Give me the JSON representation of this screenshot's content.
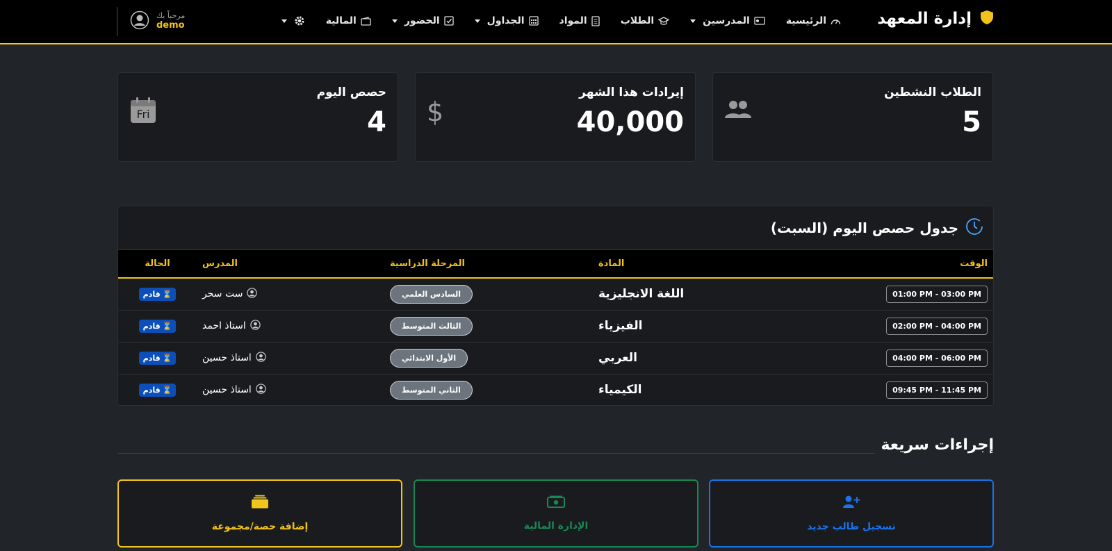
{
  "navbar": {
    "brand": "إدارة المعهد",
    "items": [
      {
        "label": "الرئيسية",
        "icon": "speedometer-icon",
        "dropdown": false
      },
      {
        "label": "المدرسين",
        "icon": "teacher-icon",
        "dropdown": true
      },
      {
        "label": "الطلاب",
        "icon": "graduation-cap-icon",
        "dropdown": false
      },
      {
        "label": "المواد",
        "icon": "journal-icon",
        "dropdown": false
      },
      {
        "label": "الجداول",
        "icon": "calendar-grid-icon",
        "dropdown": true
      },
      {
        "label": "الحضور",
        "icon": "check-square-icon",
        "dropdown": true
      },
      {
        "label": "المالية",
        "icon": "wallet-icon",
        "dropdown": false
      }
    ],
    "settings_icon": "gear-icon",
    "user": {
      "greeting": "مرحباً بك",
      "name": "demo"
    }
  },
  "stats": [
    {
      "title": "الطلاب النشطين",
      "value": "5",
      "icon": "people-icon"
    },
    {
      "title": "إيرادات هذا الشهر",
      "value": "40,000",
      "icon": "dollar-icon"
    },
    {
      "title": "حصص اليوم",
      "value": "4",
      "icon": "calendar-day-icon",
      "icon_text": "Fri"
    }
  ],
  "schedule": {
    "title": "جدول حصص اليوم (السبت)",
    "columns": [
      "الوقت",
      "المادة",
      "المرحلة الدراسية",
      "المدرس",
      "الحالة"
    ],
    "rows": [
      {
        "time": "01:00 PM - 03:00 PM",
        "subject": "اللغة الانجليزية",
        "level": "السادس العلمي",
        "teacher": "ست سحر",
        "status": "قادم"
      },
      {
        "time": "02:00 PM - 04:00 PM",
        "subject": "الفيزياء",
        "level": "الثالث المتوسط",
        "teacher": "استاذ احمد",
        "status": "قادم"
      },
      {
        "time": "04:00 PM - 06:00 PM",
        "subject": "العربي",
        "level": "الأول الابتدائي",
        "teacher": "استاذ حسين",
        "status": "قادم"
      },
      {
        "time": "09:45 PM - 11:45 PM",
        "subject": "الكيمياء",
        "level": "الثاني المتوسط",
        "teacher": "استاذ حسين",
        "status": "قادم"
      }
    ]
  },
  "quick_actions": {
    "title": "إجراءات سريعة",
    "buttons": [
      {
        "label": "تسجيل طالب جديد",
        "icon": "person-plus-icon",
        "color": "#1a73e8"
      },
      {
        "label": "الإدارة المالية",
        "icon": "cash-icon",
        "color": "#198754"
      },
      {
        "label": "إضافة حصة/مجموعة",
        "icon": "collection-icon",
        "color": "#f2c31b"
      }
    ]
  },
  "colors": {
    "accent": "#f2c31b",
    "bg": "#212429",
    "card": "#1a1b1e"
  }
}
